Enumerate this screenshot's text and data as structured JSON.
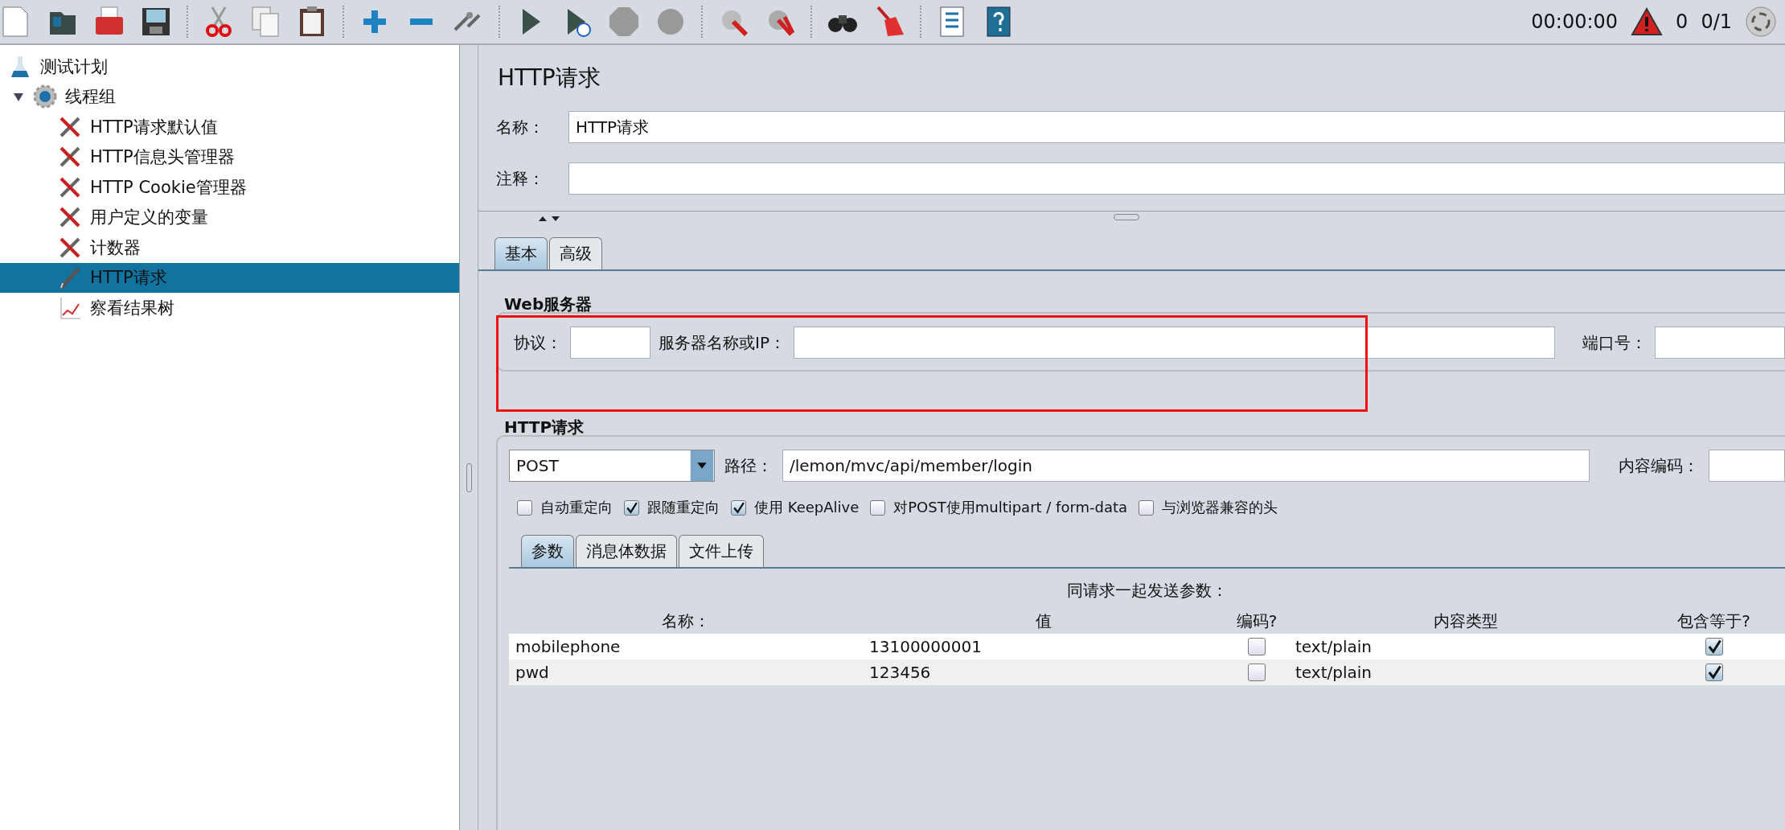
{
  "toolbar": {
    "timer": "00:00:00",
    "error_count": "0",
    "threads": "0/1"
  },
  "tree": [
    {
      "label": "测试计划",
      "kind": "plan",
      "selected": false,
      "children": [
        {
          "label": "线程组",
          "kind": "thread_group",
          "selected": false,
          "expanded": true,
          "children": [
            {
              "label": "HTTP请求默认值",
              "kind": "config",
              "selected": false
            },
            {
              "label": "HTTP信息头管理器",
              "kind": "config",
              "selected": false
            },
            {
              "label": "HTTP Cookie管理器",
              "kind": "config",
              "selected": false
            },
            {
              "label": "用户定义的变量",
              "kind": "config",
              "selected": false
            },
            {
              "label": "计数器",
              "kind": "config",
              "selected": false
            },
            {
              "label": "HTTP请求",
              "kind": "sampler",
              "selected": true
            },
            {
              "label": "察看结果树",
              "kind": "listener",
              "selected": false
            }
          ]
        }
      ]
    }
  ],
  "sampler": {
    "title": "HTTP请求",
    "name_label": "名称：",
    "name_value": "HTTP请求",
    "comment_label": "注释：",
    "tabs": [
      {
        "label": "基本",
        "selected": true
      },
      {
        "label": "高级",
        "selected": false
      }
    ],
    "web_server": {
      "title": "Web服务器",
      "protocol_label": "协议：",
      "server_label": "服务器名称或IP：",
      "port_label": "端口号："
    },
    "http_request": {
      "title": "HTTP请求",
      "method": "POST",
      "path_label": "路径：",
      "path_value": "/lemon/mvc/api/member/login",
      "encoding_label": "内容编码：",
      "options": [
        {
          "label": "自动重定向",
          "checked": false
        },
        {
          "label": "跟随重定向",
          "checked": true
        },
        {
          "label": "使用 KeepAlive",
          "checked": true
        },
        {
          "label": "对POST使用multipart / form-data",
          "checked": false
        },
        {
          "label": "与浏览器兼容的头",
          "checked": false
        }
      ],
      "tabs": [
        {
          "label": "参数",
          "selected": true
        },
        {
          "label": "消息体数据",
          "selected": false
        },
        {
          "label": "文件上传",
          "selected": false
        }
      ],
      "parameters": {
        "caption": "同请求一起发送参数：",
        "columns": [
          "名称：",
          "值",
          "编码?",
          "内容类型",
          "包含等于?"
        ],
        "rows": [
          {
            "name": "mobilephone",
            "value": "13100000001",
            "encode": false,
            "content_type": "text/plain",
            "include_equals": true
          },
          {
            "name": "pwd",
            "value": "123456",
            "encode": false,
            "content_type": "text/plain",
            "include_equals": true
          }
        ]
      }
    }
  }
}
